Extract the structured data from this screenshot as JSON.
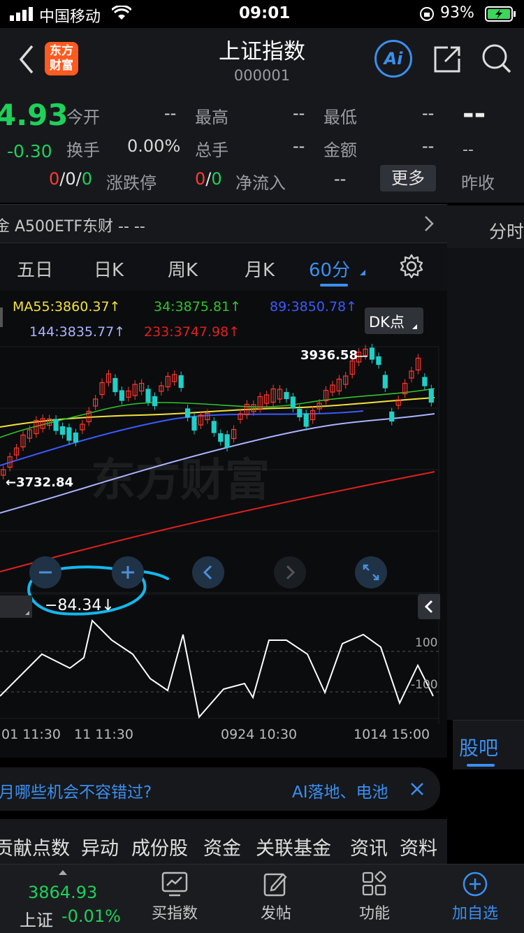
{
  "status_bar": {
    "carrier": "中国移动",
    "time": "09:01",
    "battery": "93%"
  },
  "nav": {
    "logo_text": "东方\n财富",
    "title": "上证指数",
    "code": "000001",
    "ai_label": "Ai"
  },
  "quote": {
    "price": "4.93",
    "change": "-0.30",
    "open_label": "今开",
    "open_value": "--",
    "high_label": "最高",
    "high_value": "--",
    "low_label": "最低",
    "low_value": "--",
    "turnover_label": "换手",
    "turnover_value": "0.00%",
    "volume_label": "总手",
    "volume_value": "--",
    "amount_label": "金额",
    "amount_value": "--",
    "updown_red": "0",
    "updown_sep1": "/",
    "updown_mid": "0",
    "updown_sep2": "/",
    "updown_green": "0",
    "limit_label": "涨跌停",
    "limit_red": "0",
    "limit_sep": "/",
    "limit_green": "0",
    "netflow_label": "净流入",
    "netflow_value": "--",
    "more_label": "更多"
  },
  "right_panel": {
    "big_dash": "--",
    "small_dash": "--",
    "prev_close_label": "昨收",
    "fenshi_label": "分时",
    "guba_label": "股吧"
  },
  "etf_bar": {
    "text": "金 A500ETF东财 -- --"
  },
  "chart_tabs": [
    "五日",
    "日K",
    "周K",
    "月K",
    "60分"
  ],
  "ma_legend": {
    "ma55": "MA55:3860.37↑",
    "ma34": "34:3875.81↑",
    "ma89": "89:3850.78↑",
    "ma144": "144:3835.77↑",
    "ma233": "233:3747.98↑",
    "dk_label": "DK点"
  },
  "chart_labels": {
    "high": "3936.58",
    "low": "←3732.84",
    "watermark": "东方财富",
    "indicator_value": "−84.34↓",
    "level_100": "100",
    "level_neg100": "-100",
    "time1": "01 11:30",
    "time2": "11 11:30",
    "time3": "0924 10:30",
    "time4": "1014 15:00"
  },
  "ad": {
    "left_text": "月哪些机会不容错过?",
    "right_text": "AI落地、电池"
  },
  "sub_tabs": [
    "贡献点数",
    "异动",
    "成份股",
    "资金",
    "关联基金",
    "资讯",
    "资料"
  ],
  "bottom_nav": {
    "index_price": "3864.93",
    "index_name": "上证",
    "index_change": "-0.01%",
    "buy_index": "买指数",
    "post": "发帖",
    "functions": "功能",
    "add_watch": "加自选"
  },
  "colors": {
    "ma55": "#f3e23a",
    "ma34": "#2ec52e",
    "ma89": "#3b5bff",
    "ma144": "#aab4ff",
    "ma233": "#e02020",
    "accent_blue": "#3b8ff0",
    "circle_cyan": "#12b8ee"
  }
}
